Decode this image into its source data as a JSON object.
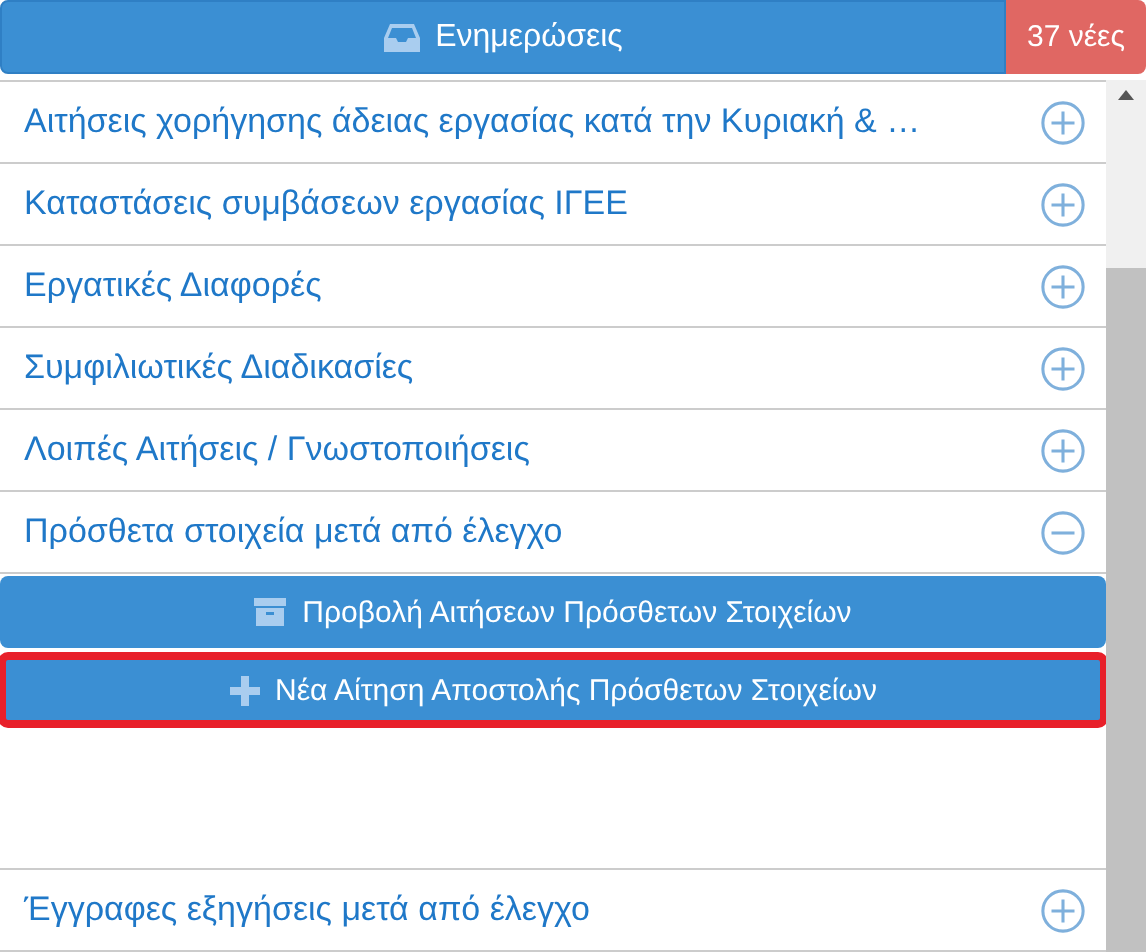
{
  "header": {
    "title": "Ενημερώσεις",
    "badge": "37 νέες"
  },
  "sections": [
    {
      "label": "Αιτήσεις χορήγησης άδειας εργασίας κατά την Κυριακή & …",
      "expanded": false
    },
    {
      "label": "Καταστάσεις συμβάσεων εργασίας ΙΓΕΕ",
      "expanded": false
    },
    {
      "label": "Εργατικές Διαφορές",
      "expanded": false
    },
    {
      "label": "Συμφιλιωτικές Διαδικασίες",
      "expanded": false
    },
    {
      "label": "Λοιπές Αιτήσεις / Γνωστοποιήσεις",
      "expanded": false
    },
    {
      "label": "Πρόσθετα στοιχεία μετά από έλεγχο",
      "expanded": true,
      "actions": [
        {
          "label": "Προβολή Αιτήσεων Πρόσθετων Στοιχείων",
          "kind": "archive",
          "highlighted": false
        },
        {
          "label": "Νέα Αίτηση Αποστολής Πρόσθετων Στοιχείων",
          "kind": "add",
          "highlighted": true
        }
      ]
    },
    {
      "label": "Έγγραφες εξηγήσεις μετά από έλεγχο",
      "expanded": false
    }
  ]
}
